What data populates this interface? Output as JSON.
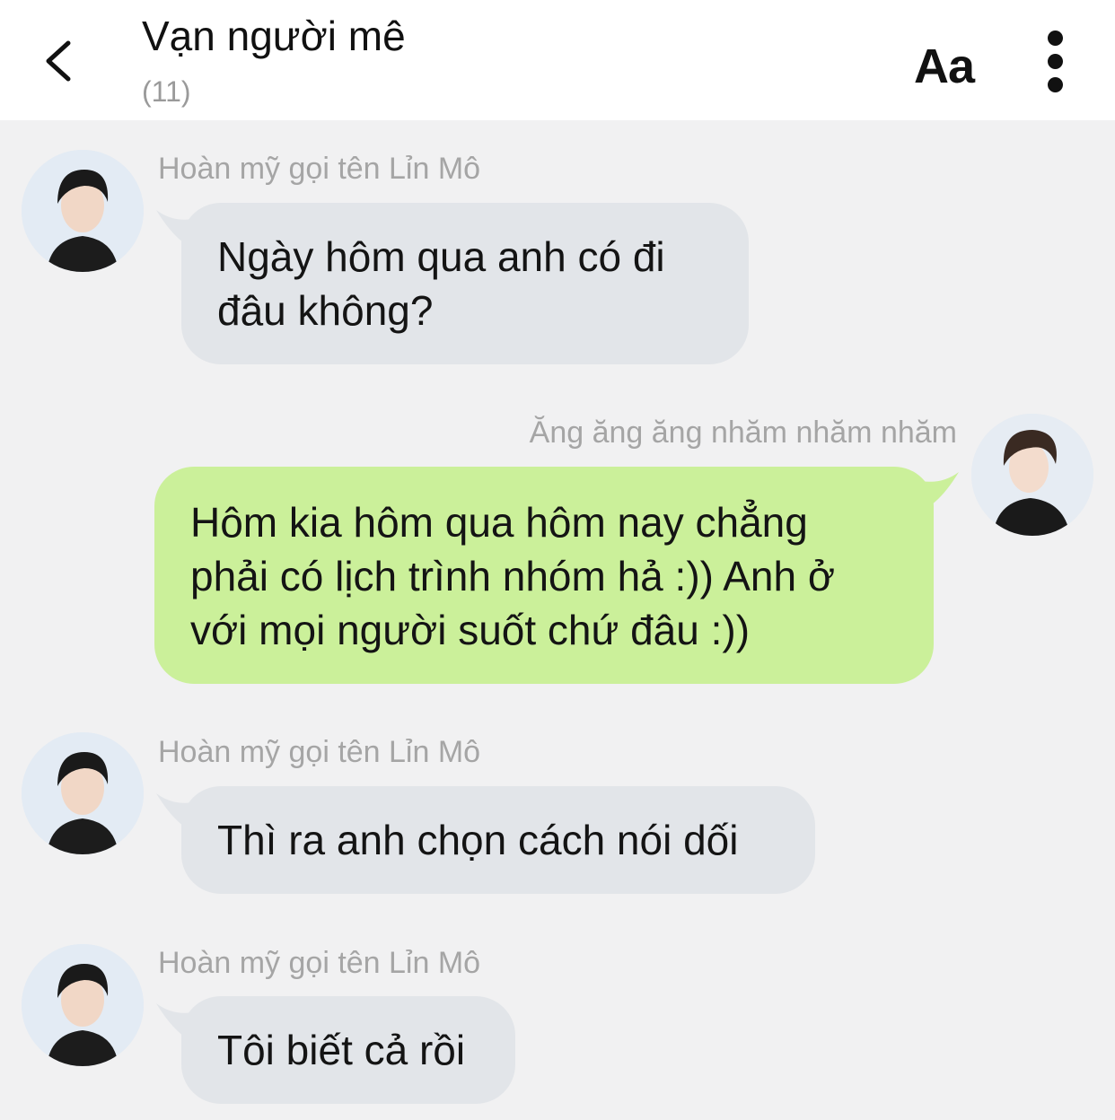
{
  "header": {
    "title": "Vạn người mê",
    "member_count": "(11)",
    "font_label": "Aa",
    "icons": {
      "back": "chevron-left-icon",
      "more": "more-vertical-icon"
    }
  },
  "colors": {
    "background": "#f1f1f2",
    "incoming_bubble": "#e2e5e9",
    "outgoing_bubble": "#cbf09a",
    "sender_name": "#a5a5a5"
  },
  "messages": [
    {
      "direction": "incoming",
      "sender": "Hoàn mỹ gọi tên Lỉn Mô",
      "lines": [
        "Ngày hôm qua anh có đi",
        "đâu không?"
      ]
    },
    {
      "direction": "outgoing",
      "sender": "Ăng ăng ăng nhăm nhăm nhăm",
      "lines": [
        "Hôm kia hôm qua hôm nay chẳng",
        "phải có lịch trình nhóm hả :)) Anh ở",
        "với mọi người suốt chứ đâu :))"
      ]
    },
    {
      "direction": "incoming",
      "sender": "Hoàn mỹ gọi tên Lỉn Mô",
      "lines": [
        "Thì ra anh chọn cách nói dối"
      ]
    },
    {
      "direction": "incoming",
      "sender": "Hoàn mỹ gọi tên Lỉn Mô",
      "lines": [
        "Tôi biết cả rồi"
      ]
    }
  ]
}
